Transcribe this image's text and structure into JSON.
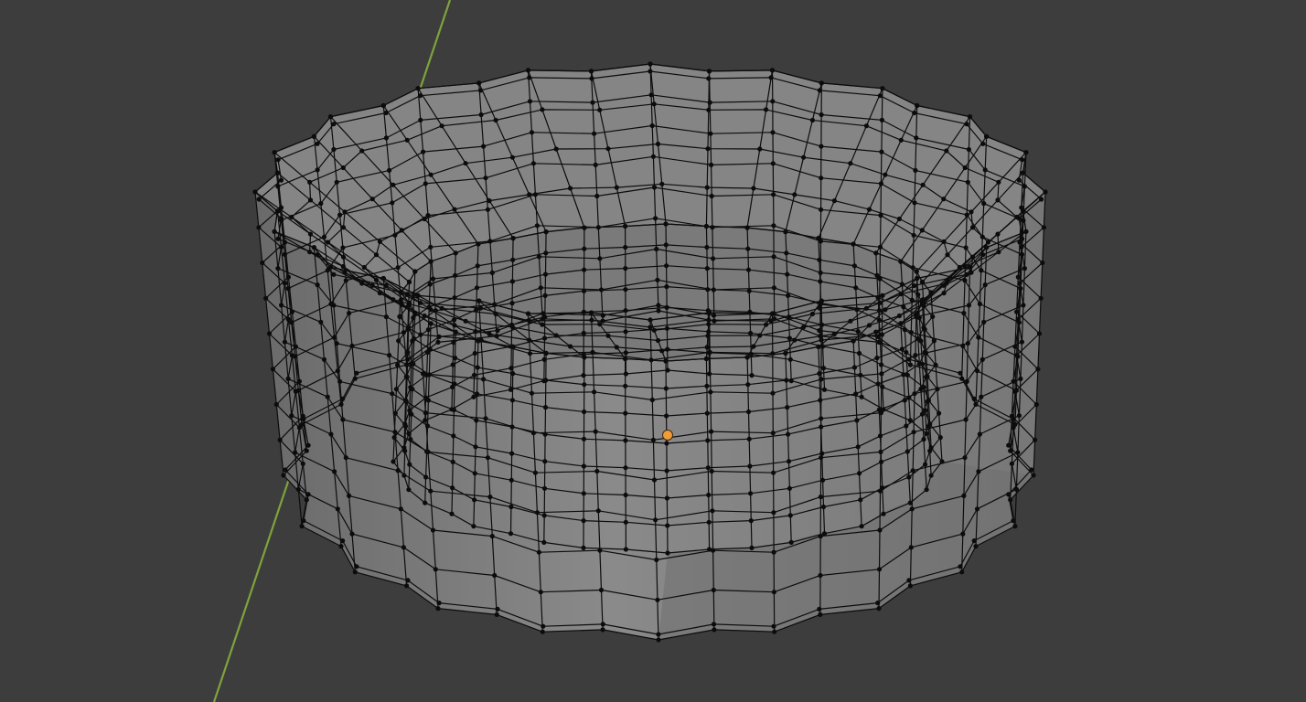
{
  "viewport": {
    "background_color": "#3d3d3d",
    "mode": "edit-mode-wireframe-xray"
  },
  "axis": {
    "name": "y-axis-line",
    "color": "#7fa33c"
  },
  "mesh": {
    "shape": "ribbed-bowl",
    "face_color": "#8a8a8a",
    "face_shadow_color": "#6f6f6f",
    "inner_color": "#7a7a7a",
    "edge_color": "#0c0c0c",
    "vertex_color": "#0c0c0c",
    "outer_ribs": 20,
    "inner_ribs": 16
  },
  "origin": {
    "color": "#f29c38"
  }
}
